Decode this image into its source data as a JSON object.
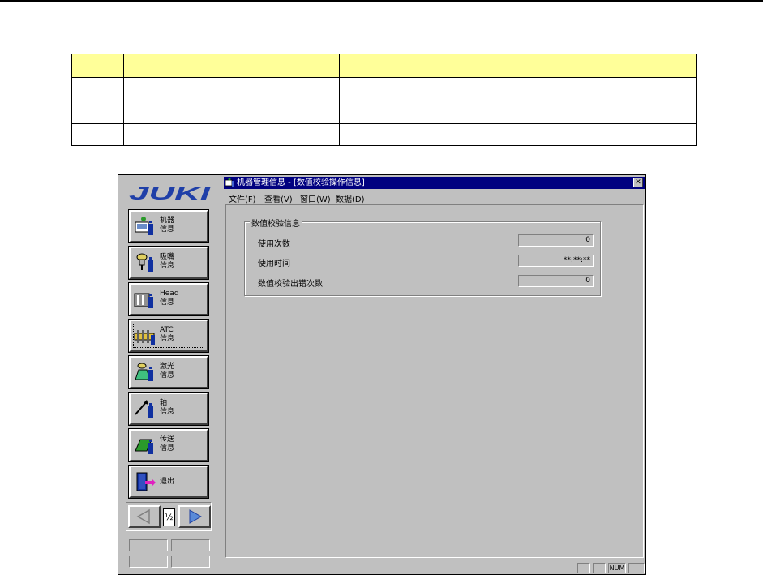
{
  "app": {
    "logo_text": "JUKI",
    "window_title": "机器管理信息 - [数值校验操作信息]",
    "close_glyph": "✕",
    "menu": [
      {
        "label": "文件(F)"
      },
      {
        "label": "查看(V)"
      },
      {
        "label": "窗口(W)"
      },
      {
        "label": "数据(D)"
      }
    ]
  },
  "sidebar": {
    "buttons": [
      {
        "label": "机器\n信息",
        "icon": "machine-info-icon"
      },
      {
        "label": "吸嘴\n信息",
        "icon": "nozzle-info-icon"
      },
      {
        "label": "Head\n信息",
        "icon": "head-info-icon"
      },
      {
        "label": "ATC\n信息",
        "icon": "atc-info-icon"
      },
      {
        "label": "激光\n信息",
        "icon": "laser-info-icon"
      },
      {
        "label": "轴\n信息",
        "icon": "axis-info-icon"
      },
      {
        "label": "传送\n信息",
        "icon": "conveyor-info-icon"
      },
      {
        "label": "退出",
        "icon": "exit-door-icon"
      }
    ],
    "page_indicator": "½"
  },
  "group": {
    "title": "数值校验信息",
    "rows": [
      {
        "label": "使用次数",
        "value": "0"
      },
      {
        "label": "使用时间",
        "value": "**:**:**"
      },
      {
        "label": "数值校验出错次数",
        "value": "0"
      }
    ]
  },
  "statusbar": {
    "num": "NUM"
  },
  "colors": {
    "table_header": "#ffff99",
    "title_bar": "#000080",
    "window_face": "#c0c0c0"
  }
}
